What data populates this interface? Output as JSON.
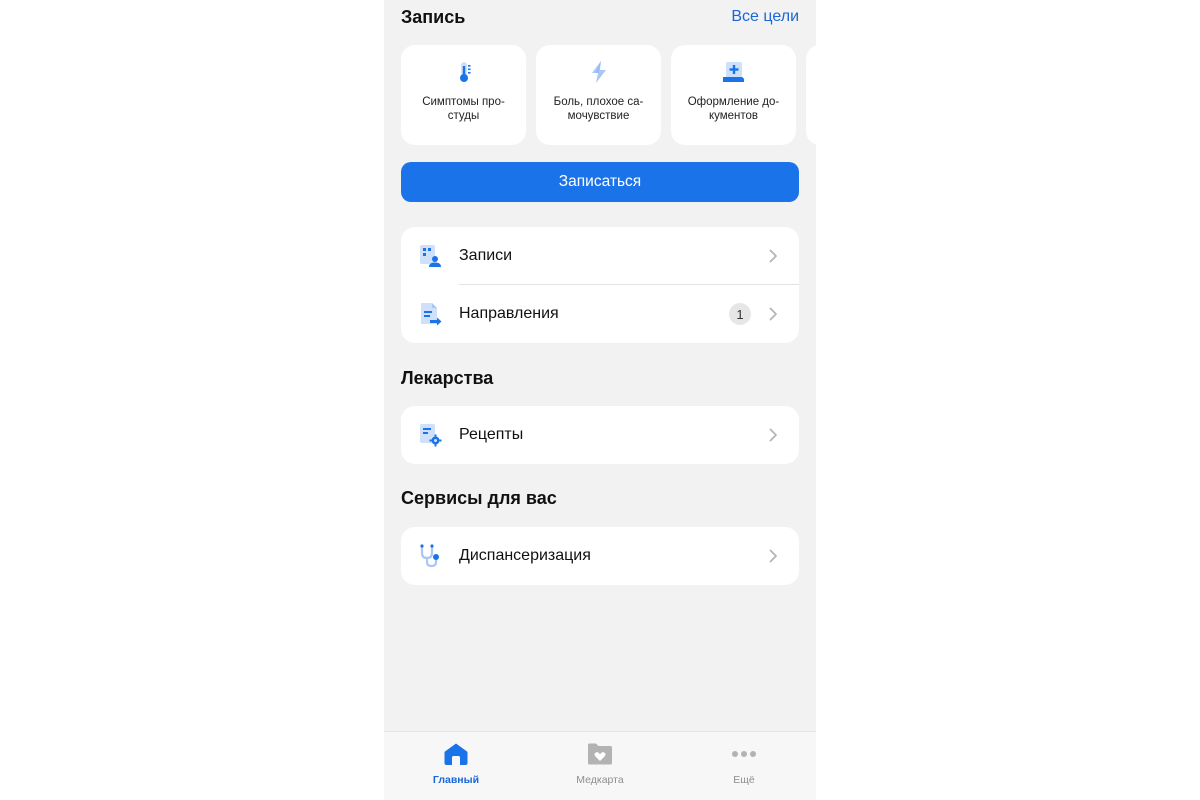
{
  "colors": {
    "accent": "#1a73e8",
    "link": "#1a66d9",
    "background": "#f2f2f2",
    "inactive": "#8e8e8e"
  },
  "record_section": {
    "title": "Запись",
    "all_goals_link": "Все цели",
    "goals": [
      {
        "icon": "thermometer-icon",
        "label": "Симптомы про-\nстуды"
      },
      {
        "icon": "lightning-icon",
        "label": "Боль, плохое са-\nмочувствие"
      },
      {
        "icon": "document-plus-icon",
        "label": "Оформление до-\nкументов"
      }
    ],
    "book_button": "Записаться"
  },
  "appointments_group": {
    "items": [
      {
        "icon": "appointments-icon",
        "label": "Записи"
      },
      {
        "icon": "referral-icon",
        "label": "Направления",
        "badge": "1"
      }
    ]
  },
  "medicines_section": {
    "title": "Лекарства",
    "items": [
      {
        "icon": "prescription-icon",
        "label": "Рецепты"
      }
    ]
  },
  "services_section": {
    "title": "Сервисы для вас",
    "items": [
      {
        "icon": "stethoscope-icon",
        "label": "Диспансеризация"
      }
    ]
  },
  "tabbar": {
    "tabs": [
      {
        "icon": "home-icon",
        "label": "Главный",
        "active": true
      },
      {
        "icon": "medical-card-icon",
        "label": "Медкарта",
        "active": false
      },
      {
        "icon": "more-dots-icon",
        "label": "Ещё",
        "active": false
      }
    ]
  }
}
